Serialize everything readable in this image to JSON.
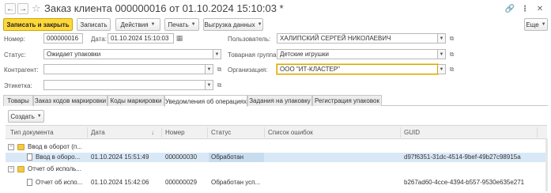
{
  "window": {
    "title": "Заказ клиента 000000016 от 01.10.2024 15:10:03 *",
    "icons": [
      "back-arrow-icon",
      "forward-arrow-icon",
      "star-icon",
      "link-icon",
      "more-vertical-icon",
      "close-icon"
    ],
    "more_label": "Еще"
  },
  "toolbar": {
    "save_close": "Записать и закрыть",
    "save": "Записать",
    "actions": "Действия",
    "print": "Печать",
    "export": "Выгрузка данных"
  },
  "form": {
    "number_label": "Номер:",
    "number_value": "000000016",
    "date_label": "Дата:",
    "date_value": "01.10.2024 15:10:03",
    "user_label": "Пользователь:",
    "user_value": "ХАЛИПСКИЙ СЕРГЕЙ НИКОЛАЕВИЧ",
    "status_label": "Статус:",
    "status_value": "Ожидает упаковки",
    "product_group_label": "Товарная группа:",
    "product_group_value": "Детские игрушки",
    "counterparty_label": "Контрагент:",
    "counterparty_value": "",
    "organization_label": "Организация:",
    "organization_value": "ООО \"ИТ-КЛАСТЕР\"",
    "label_label": "Этикетка:",
    "label_value": ""
  },
  "tabs": [
    {
      "label": "Товары",
      "active": false
    },
    {
      "label": "Заказ кодов маркировки",
      "active": false
    },
    {
      "label": "Коды маркировки",
      "active": false
    },
    {
      "label": "Уведомления об операциях",
      "active": true
    },
    {
      "label": "Задания на упаковку",
      "active": false
    },
    {
      "label": "Регистрация упаковок",
      "active": false
    }
  ],
  "subtoolbar": {
    "create": "Создать"
  },
  "table": {
    "columns": [
      "Тип документа",
      "Дата",
      "Номер",
      "Статус",
      "Список ошибок",
      "GUID"
    ],
    "sort_indicator": "↓",
    "rows": [
      {
        "type": "group",
        "toggle": "⊟",
        "doc_type": "Ввод в оборот (п...",
        "date": "",
        "number": "",
        "status": "",
        "errors": "",
        "guid": ""
      },
      {
        "type": "item",
        "doc_type": "Ввод в оборо...",
        "date": "01.10.2024 15:51:49",
        "number": "000000030",
        "status": "Обработан",
        "errors": "",
        "guid": "d97f6351-31dc-4514-9bef-49b27c98915a",
        "selected": true
      },
      {
        "type": "group",
        "toggle": "⊟",
        "doc_type": "Отчет об исполь...",
        "date": "",
        "number": "",
        "status": "",
        "errors": "",
        "guid": ""
      },
      {
        "type": "item",
        "doc_type": "Отчет об испо...",
        "date": "01.10.2024 15:42:06",
        "number": "000000029",
        "status": "Обработан усп...",
        "errors": "",
        "guid": "b267ad60-4cce-4394-b557-9530e635e271",
        "selected": false
      }
    ]
  },
  "colors": {
    "accent": "#ffd83a",
    "selection": "#d9e8f6",
    "status_cell": "#c8dcf0"
  }
}
